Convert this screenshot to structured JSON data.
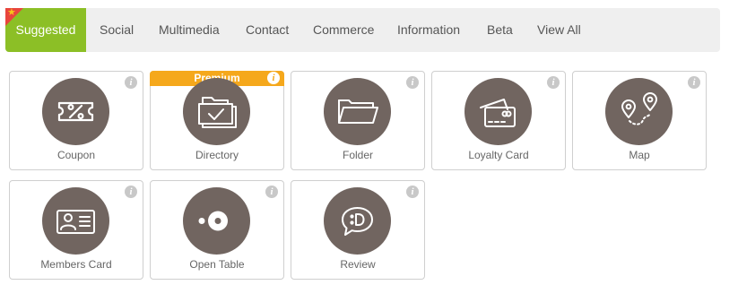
{
  "tabs": [
    {
      "label": "Suggested",
      "active": true
    },
    {
      "label": "Social"
    },
    {
      "label": "Multimedia"
    },
    {
      "label": "Contact"
    },
    {
      "label": "Commerce"
    },
    {
      "label": "Information"
    },
    {
      "label": "Beta"
    },
    {
      "label": "View All"
    }
  ],
  "cards": [
    {
      "label": "Coupon",
      "icon": "coupon-icon"
    },
    {
      "label": "Directory",
      "icon": "directory-icon",
      "badge": "Premium"
    },
    {
      "label": "Folder",
      "icon": "folder-icon"
    },
    {
      "label": "Loyalty Card",
      "icon": "loyalty-card-icon"
    },
    {
      "label": "Map",
      "icon": "map-icon"
    },
    {
      "label": "Members Card",
      "icon": "members-card-icon"
    },
    {
      "label": "Open Table",
      "icon": "open-table-icon"
    },
    {
      "label": "Review",
      "icon": "review-icon"
    }
  ],
  "info_glyph": "i",
  "colors": {
    "active_tab": "#8cbf26",
    "corner_ribbon": "#e8453c",
    "premium_badge": "#f5a81c",
    "icon_circle": "#716560"
  }
}
